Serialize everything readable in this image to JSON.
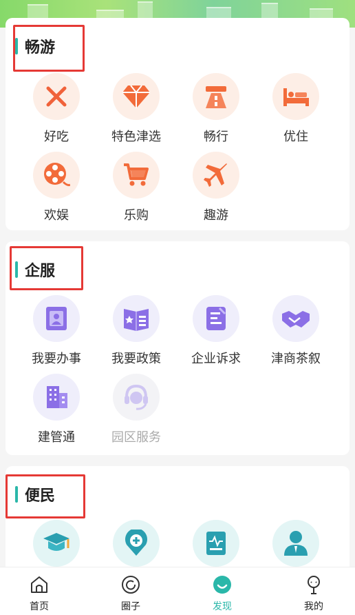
{
  "sections": [
    {
      "title": "畅游",
      "items": [
        {
          "label": "好吃",
          "icon": "fork-knife-icon"
        },
        {
          "label": "特色津选",
          "icon": "diamond-icon"
        },
        {
          "label": "畅行",
          "icon": "road-icon"
        },
        {
          "label": "优住",
          "icon": "bed-icon"
        },
        {
          "label": "欢娱",
          "icon": "film-reel-icon"
        },
        {
          "label": "乐购",
          "icon": "shopping-cart-icon"
        },
        {
          "label": "趣游",
          "icon": "airplane-icon"
        }
      ]
    },
    {
      "title": "企服",
      "items": [
        {
          "label": "我要办事",
          "icon": "person-card-icon"
        },
        {
          "label": "我要政策",
          "icon": "open-book-icon"
        },
        {
          "label": "企业诉求",
          "icon": "edit-document-icon"
        },
        {
          "label": "津商茶叙",
          "icon": "handshake-icon"
        },
        {
          "label": "建管通",
          "icon": "buildings-icon"
        },
        {
          "label": "园区服务",
          "icon": "headset-service-icon"
        }
      ]
    },
    {
      "title": "便民",
      "items": [
        {
          "label": "",
          "icon": "graduation-cap-icon"
        },
        {
          "label": "",
          "icon": "medical-location-icon"
        },
        {
          "label": "",
          "icon": "medical-record-icon"
        },
        {
          "label": "",
          "icon": "person-icon"
        }
      ]
    }
  ],
  "tabbar": [
    {
      "label": "首页",
      "icon": "home-icon"
    },
    {
      "label": "圈子",
      "icon": "circle-refresh-icon"
    },
    {
      "label": "发现",
      "icon": "discover-smile-icon"
    },
    {
      "label": "我的",
      "icon": "profile-icon"
    }
  ],
  "colors": {
    "accent": "#2ab7a9",
    "highlight_box": "#e53935"
  }
}
